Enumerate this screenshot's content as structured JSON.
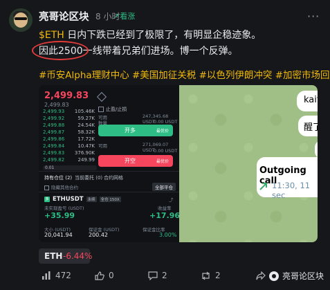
{
  "author": {
    "name": "亮哥论区块",
    "time": "8 小时",
    "sentiment": "看涨"
  },
  "post": {
    "line1_ticker": "$ETH",
    "line1_rest": " 日内下跌已经到了极限了，有明显企稳迹象。",
    "line2": "因此2500一线带着兄弟们进场。博一个反弹。",
    "tags": "#币安Alpha理财中心 #美国加征关税 #以色列伊朗冲突 #加密市场回调"
  },
  "screenshot": {
    "price": "2,499.83",
    "price_sub": "2,499.83",
    "orderbook": [
      {
        "p": "2,499.93",
        "q": "105.46K"
      },
      {
        "p": "2,499.92",
        "q": "59.27K"
      },
      {
        "p": "2,499.88",
        "q": "24.54K"
      },
      {
        "p": "2,499.87",
        "q": "58.32K"
      },
      {
        "p": "2,499.86",
        "q": "17.72K"
      },
      {
        "p": "2,499.84",
        "q": "10.47K"
      },
      {
        "p": "2,499.83",
        "q": "376.90K"
      },
      {
        "p": "2,499.82",
        "q": "249.99"
      }
    ],
    "order_type": "止盈/止损",
    "qty_label": "数量",
    "avail_label": "可用",
    "avail_value": "247,345.68 USDT",
    "buy_label": "开多",
    "buy_sub": "最优价",
    "buy_cost": "0.00 USDT",
    "sell_avail": "271,069.07 USDT",
    "sell_label": "开空",
    "sell_sub": "最优价",
    "sell_cost": "0.00 USDT",
    "tabs": [
      "持有仓位 (2)",
      "当前委托 (0)",
      "合约网格"
    ],
    "hide_other": "隐藏其他合约",
    "close_all": "全部平仓",
    "symbol": "ETHUSDT",
    "symbol_tags": [
      "永续",
      "全仓 150X"
    ],
    "pnl_label": "未实现盈亏 (USDT)",
    "pnl": "+35.99",
    "roi_label": "收益率",
    "roi": "+17.96%",
    "size_label": "大小 (USDT)",
    "size": "20,041.94",
    "margin_label": "保证金 (USDT)",
    "margin": "200.42",
    "ratio_label": "保证金比率",
    "ratio": "3.00%",
    "chat": {
      "b1": "kait",
      "b2": "醒了",
      "call_title": "Outgoing call",
      "call_time": "11:30, 11 sec"
    }
  },
  "ticker": {
    "symbol": "ETH",
    "change": "-6.44%"
  },
  "actions": {
    "views": "472",
    "likes": "0",
    "comments": "2",
    "reposts": "2"
  },
  "watermark": "亮哥论区块",
  "colors": {
    "up": "#2ebd85",
    "down": "#f6465d",
    "tag": "#f0b90b",
    "circle": "#e23b3b"
  }
}
